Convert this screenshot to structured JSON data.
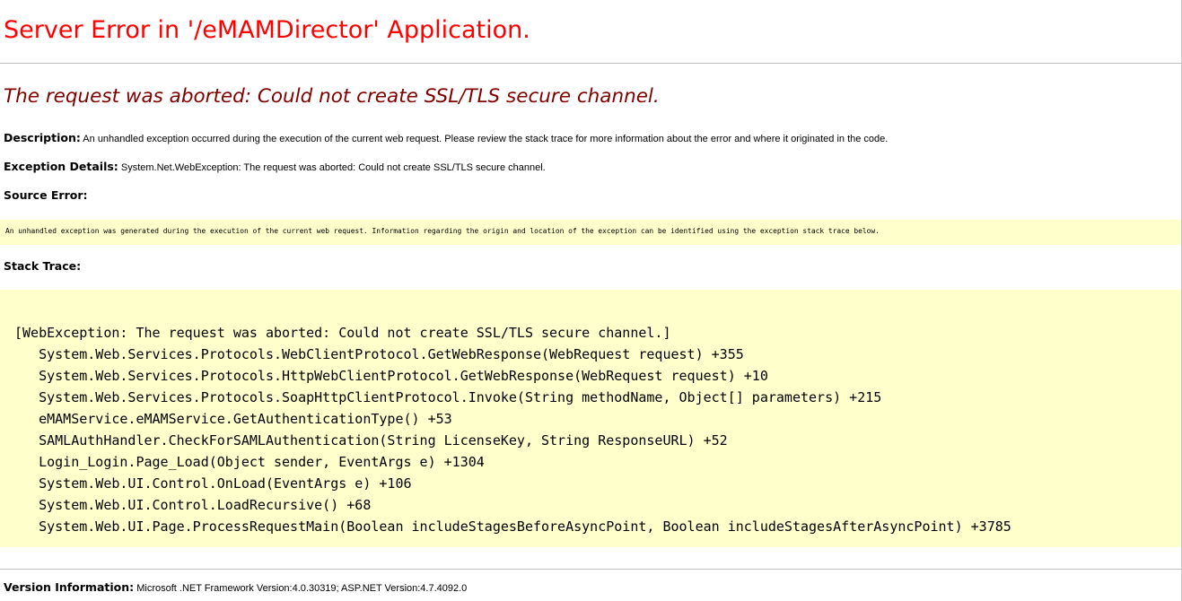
{
  "page": {
    "title": "Server Error in '/eMAMDirector' Application.",
    "subtitle": "The request was aborted: Could not create SSL/TLS secure channel."
  },
  "description": {
    "label": "Description:",
    "text": " An unhandled exception occurred during the execution of the current web request. Please review the stack trace for more information about the error and where it originated in the code."
  },
  "exception_details": {
    "label": "Exception Details:",
    "text": " System.Net.WebException: The request was aborted: Could not create SSL/TLS secure channel."
  },
  "source_error": {
    "label": "Source Error:",
    "text": "An unhandled exception was generated during the execution of the current web request. Information regarding the origin and location of the exception can be identified using the exception stack trace below."
  },
  "stack_trace": {
    "label": "Stack Trace:",
    "lines": [
      "[WebException: The request was aborted: Could not create SSL/TLS secure channel.]",
      "   System.Web.Services.Protocols.WebClientProtocol.GetWebResponse(WebRequest request) +355",
      "   System.Web.Services.Protocols.HttpWebClientProtocol.GetWebResponse(WebRequest request) +10",
      "   System.Web.Services.Protocols.SoapHttpClientProtocol.Invoke(String methodName, Object[] parameters) +215",
      "   eMAMService.eMAMService.GetAuthenticationType() +53",
      "   SAMLAuthHandler.CheckForSAMLAuthentication(String LicenseKey, String ResponseURL) +52",
      "   Login_Login.Page_Load(Object sender, EventArgs e) +1304",
      "   System.Web.UI.Control.OnLoad(EventArgs e) +106",
      "   System.Web.UI.Control.LoadRecursive() +68",
      "   System.Web.UI.Page.ProcessRequestMain(Boolean includeStagesBeforeAsyncPoint, Boolean includeStagesAfterAsyncPoint) +3785"
    ]
  },
  "version_information": {
    "label": "Version Information:",
    "text": " Microsoft .NET Framework Version:4.0.30319; ASP.NET Version:4.7.4092.0"
  },
  "colors": {
    "title": "#ff0000",
    "subtitle": "#800000",
    "code_background": "#ffffcc",
    "rule": "#c0c0c0"
  }
}
